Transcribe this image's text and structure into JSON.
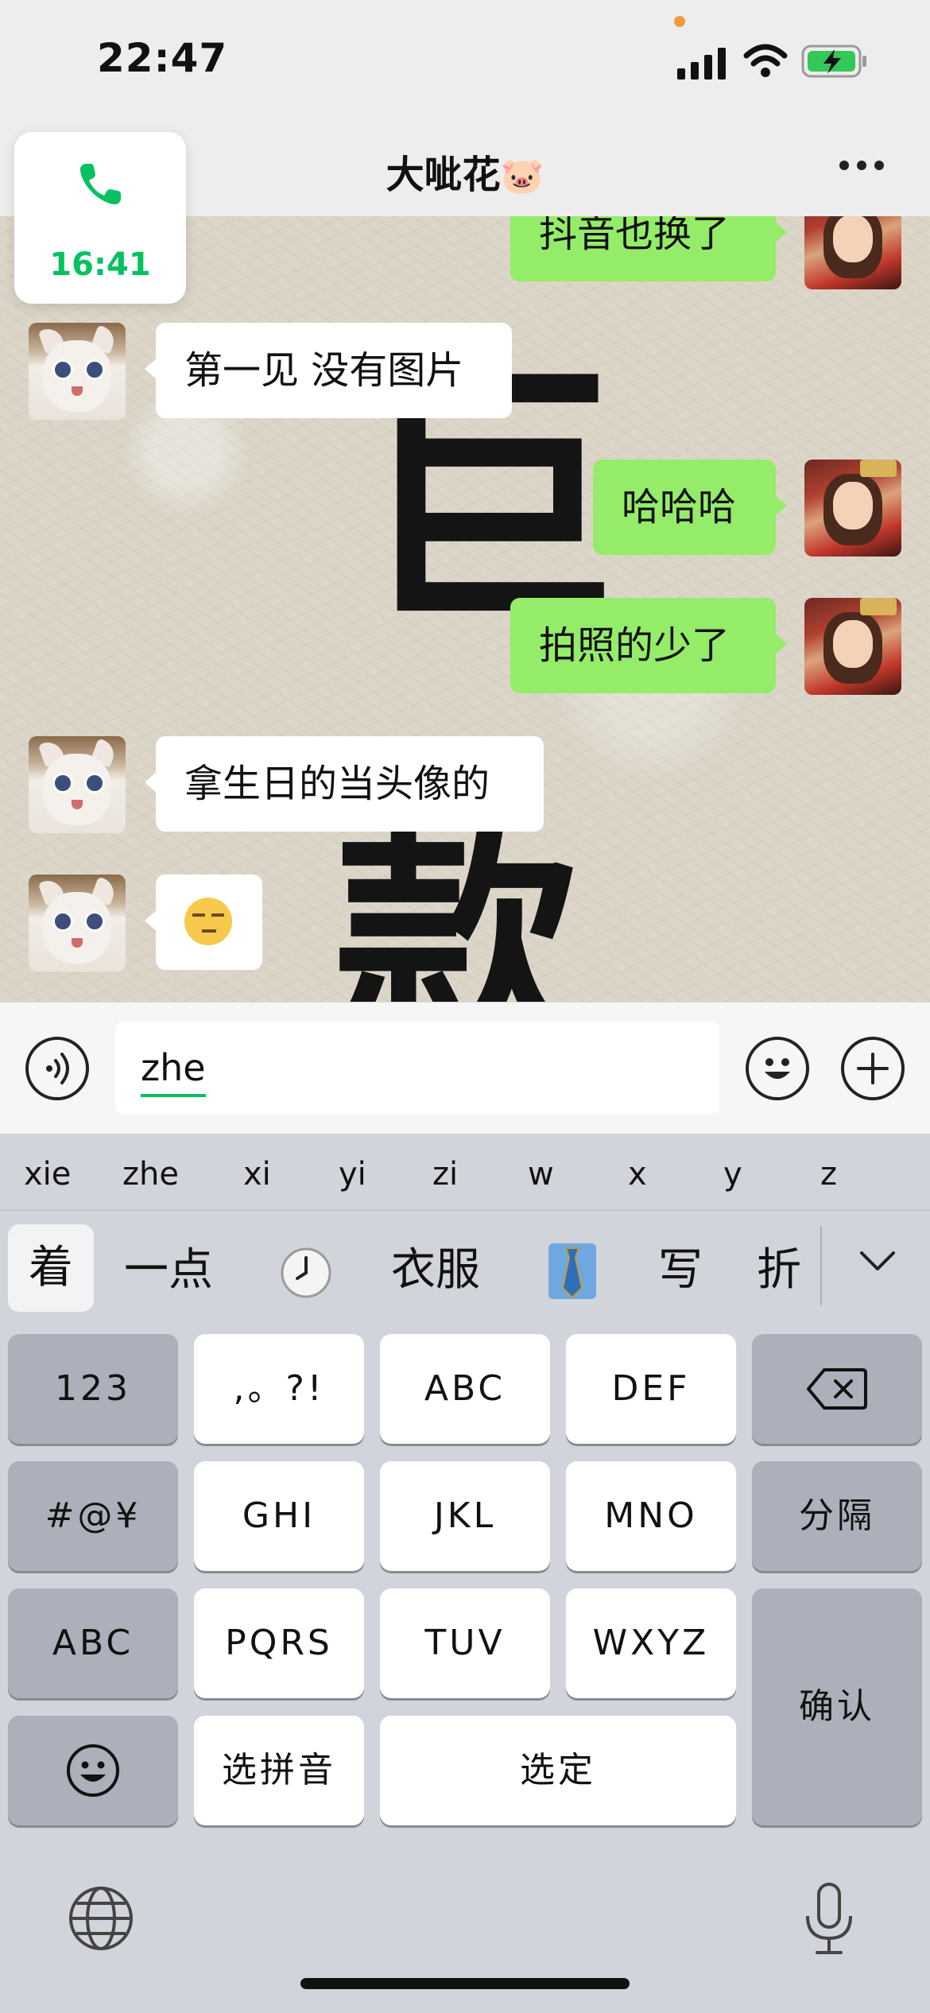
{
  "status_bar": {
    "time": "22:47"
  },
  "nav": {
    "title": "大呲花",
    "title_emoji": "🐷"
  },
  "call": {
    "duration": "16:41"
  },
  "messages": [
    {
      "side": "out",
      "text": "抖音也换了"
    },
    {
      "side": "in",
      "text": "第一见 没有图片"
    },
    {
      "side": "out",
      "text": "哈哈哈"
    },
    {
      "side": "out",
      "text": "拍照的少了"
    },
    {
      "side": "in",
      "text": "拿生日的当头像的"
    },
    {
      "side": "in",
      "emoji": "unamused-face-emoji"
    }
  ],
  "background_text": [
    "巨",
    "款"
  ],
  "input": {
    "composing_text": "zhe"
  },
  "keyboard": {
    "pinyin_options": [
      "xie",
      "zhe",
      "xi",
      "yi",
      "zi",
      "w",
      "x",
      "y",
      "z"
    ],
    "candidates": [
      "着",
      "一点",
      "clock-emoji",
      "衣服",
      "necktie-emoji",
      "写",
      "折"
    ],
    "keys": {
      "k123": "123",
      "punct": ",。?!",
      "abc1": "ABC",
      "def": "DEF",
      "symbols": "#@¥",
      "ghi": "GHI",
      "jkl": "JKL",
      "mno": "MNO",
      "separator": "分隔",
      "abc_switch": "ABC",
      "pqrs": "PQRS",
      "tuv": "TUV",
      "wxyz": "WXYZ",
      "confirm": "确认",
      "select_pinyin": "选拼音",
      "select": "选定"
    }
  }
}
